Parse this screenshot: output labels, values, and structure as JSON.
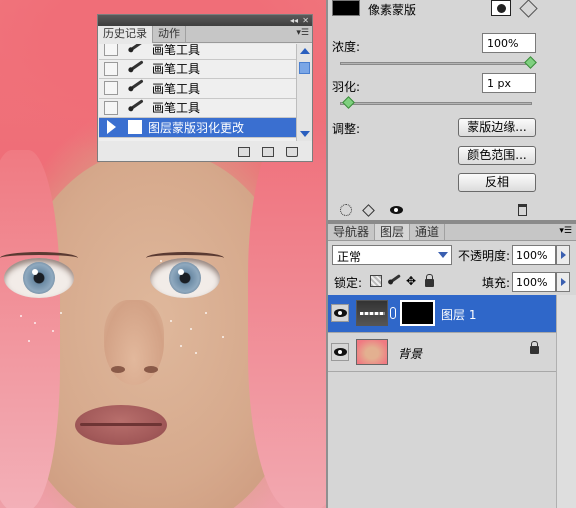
{
  "history_panel": {
    "tabs": [
      "历史记录",
      "动作"
    ],
    "active_tab": 0,
    "items": [
      {
        "label": "画笔工具",
        "icon": "brush-icon"
      },
      {
        "label": "画笔工具",
        "icon": "brush-icon"
      },
      {
        "label": "画笔工具",
        "icon": "brush-icon"
      },
      {
        "label": "画笔工具",
        "icon": "brush-icon"
      },
      {
        "label": "图层蒙版羽化更改",
        "icon": "document-icon",
        "selected": true
      }
    ]
  },
  "mask_panel": {
    "title": "像素蒙版",
    "density_label": "浓度:",
    "density_value": "100%",
    "feather_label": "羽化:",
    "feather_value": "1 px",
    "adjust_label": "调整:",
    "buttons": [
      "蒙版边缘...",
      "颜色范围...",
      "反相"
    ]
  },
  "layers_panel": {
    "tabs": [
      "导航器",
      "图层",
      "通道"
    ],
    "active_tab": 1,
    "blend_mode": "正常",
    "opacity_label": "不透明度:",
    "opacity_value": "100%",
    "lock_label": "锁定:",
    "fill_label": "填充:",
    "fill_value": "100%",
    "layers": [
      {
        "name": "图层 1",
        "selected": true
      },
      {
        "name": "背景",
        "selected": false
      }
    ]
  },
  "colors": {
    "selection": "#2f67c9",
    "hair": "#f0757c",
    "skin": "#d6a98c"
  }
}
